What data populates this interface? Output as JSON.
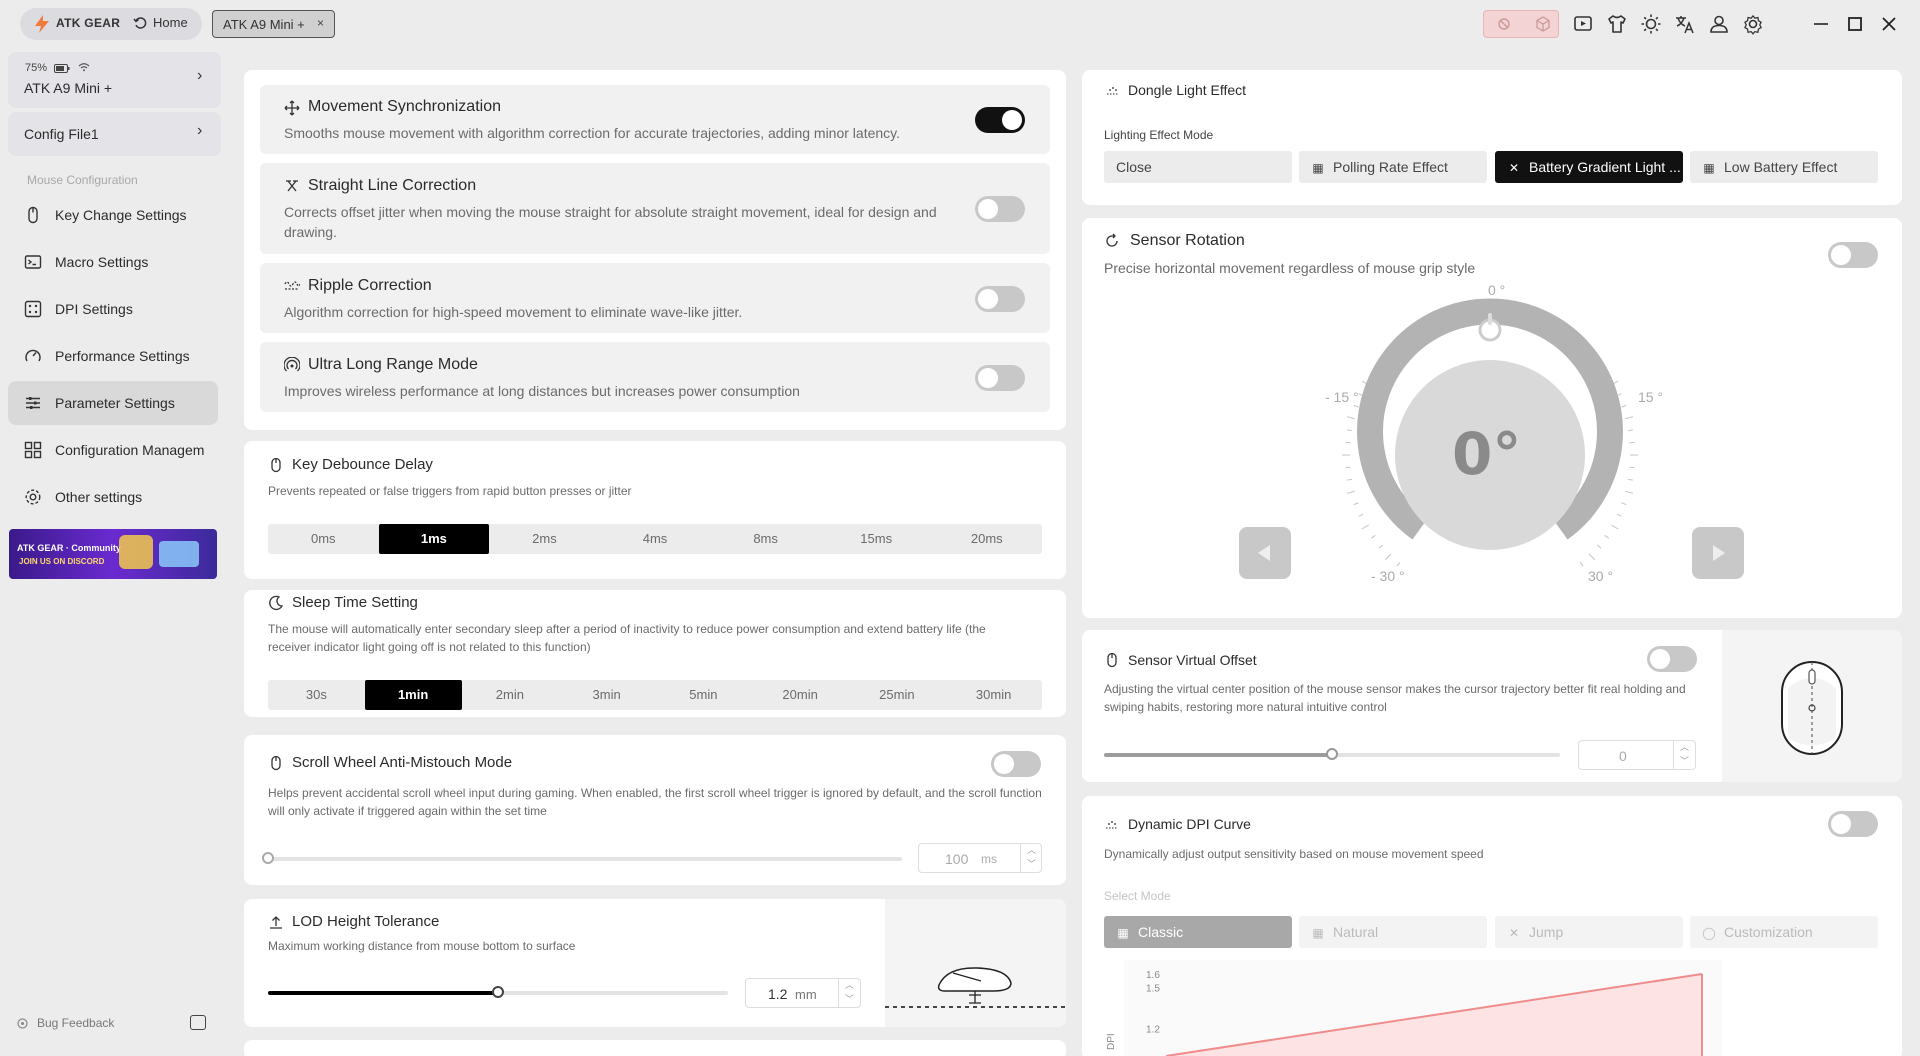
{
  "titlebar": {
    "brand": "ATK GEAR",
    "home": "Home",
    "device_tab": "ATK A9 Mini +",
    "device_tab_close": "×",
    "icons": [
      "no-connection-icon",
      "cube-icon",
      "video-icon",
      "shirt-icon",
      "brightness-icon",
      "translate-icon",
      "user-icon",
      "gear-icon",
      "minimize-icon",
      "maximize-icon",
      "close-icon"
    ]
  },
  "sidebar": {
    "battery": "75%",
    "device_name": "ATK A9 Mini +",
    "config": "Config File1",
    "section": "Mouse Configuration",
    "items": [
      {
        "label": "Key Change Settings",
        "icon": "mouse-icon"
      },
      {
        "label": "Macro Settings",
        "icon": "macro-icon"
      },
      {
        "label": "DPI Settings",
        "icon": "dpi-icon"
      },
      {
        "label": "Performance Settings",
        "icon": "gauge-icon"
      },
      {
        "label": "Parameter Settings",
        "icon": "sliders-icon",
        "active": true
      },
      {
        "label": "Configuration Managem",
        "icon": "grid-icon"
      },
      {
        "label": "Other settings",
        "icon": "settings-icon"
      }
    ],
    "banner_line1": "ATK GEAR · Community",
    "banner_line2": "JOIN US ON DISCORD",
    "bug": "Bug Feedback"
  },
  "left": {
    "movement": {
      "title": "Movement Synchronization",
      "desc": "Smooths mouse movement with algorithm correction for accurate trajectories, adding minor latency.",
      "on": true
    },
    "straight": {
      "title": "Straight Line Correction",
      "desc": "Corrects offset jitter when moving the mouse straight for absolute straight movement, ideal for design and drawing.",
      "on": false
    },
    "ripple": {
      "title": "Ripple Correction",
      "desc": "Algorithm correction for high-speed movement to eliminate wave-like jitter.",
      "on": false
    },
    "ultra": {
      "title": "Ultra Long Range Mode",
      "desc": "Improves wireless performance at long distances but increases power consumption",
      "on": false
    },
    "debounce": {
      "title": "Key Debounce Delay",
      "desc": "Prevents repeated or false triggers from rapid button presses or jitter",
      "options": [
        "0ms",
        "1ms",
        "2ms",
        "4ms",
        "8ms",
        "15ms",
        "20ms"
      ],
      "selected": "1ms"
    },
    "sleep": {
      "title": "Sleep Time Setting",
      "desc": "The mouse will automatically enter secondary sleep after a period of inactivity to reduce power consumption and extend battery life (the receiver indicator light going off is not related to this function)",
      "options": [
        "30s",
        "1min",
        "2min",
        "3min",
        "5min",
        "20min",
        "25min",
        "30min"
      ],
      "selected": "1min"
    },
    "scroll": {
      "title": "Scroll Wheel Anti-Mistouch Mode",
      "desc": "Helps prevent accidental scroll wheel input during gaming. When enabled, the first scroll wheel trigger is ignored by default, and the scroll function will only activate if triggered again within the set time",
      "value": "100",
      "unit": "ms",
      "on": false,
      "level": 0
    },
    "lod": {
      "title": "LOD Height Tolerance",
      "desc": "Maximum working distance from mouse bottom to surface",
      "value": "1.2",
      "unit": "mm",
      "level": 0.5
    }
  },
  "right": {
    "dongle": {
      "title": "Dongle Light Effect",
      "mode_label": "Lighting Effect Mode",
      "modes": [
        {
          "label": "Close",
          "icon": ""
        },
        {
          "label": "Polling Rate Effect",
          "icon": "▦"
        },
        {
          "label": "Battery Gradient Light ...",
          "icon": "✕"
        },
        {
          "label": "Low Battery Effect",
          "icon": "▦"
        }
      ],
      "selected": 2
    },
    "rotation": {
      "title": "Sensor Rotation",
      "desc": "Precise horizontal movement regardless of mouse grip style",
      "value": "0°",
      "labels": {
        "top": "0 °",
        "left15": "- 15 °",
        "right15": "15 °",
        "left30": "- 30 °",
        "right30": "30 °"
      },
      "on": false
    },
    "offset": {
      "title": "Sensor Virtual Offset",
      "desc": "Adjusting the virtual center position of the mouse sensor makes the cursor trajectory better fit real holding and swiping habits, restoring more natural intuitive control",
      "value": "0",
      "on": false,
      "level": 0.5
    },
    "dpi": {
      "title": "Dynamic DPI Curve",
      "desc": "Dynamically adjust output sensitivity based on mouse movement speed",
      "mode_label": "Select Mode",
      "modes": [
        {
          "label": "Classic",
          "icon": "▦"
        },
        {
          "label": "Natural",
          "icon": "▦"
        },
        {
          "label": "Jump",
          "icon": "✕"
        },
        {
          "label": "Customization",
          "icon": "◯"
        }
      ],
      "selected": 0,
      "on": false,
      "y_ticks": [
        "1.6",
        "1.5",
        "1.2"
      ],
      "y_axis_label": "DPI",
      "chart_data": {
        "type": "area",
        "x": [
          0,
          1
        ],
        "y": [
          1.0,
          1.6
        ],
        "ylim": [
          1.0,
          1.6
        ]
      }
    }
  }
}
